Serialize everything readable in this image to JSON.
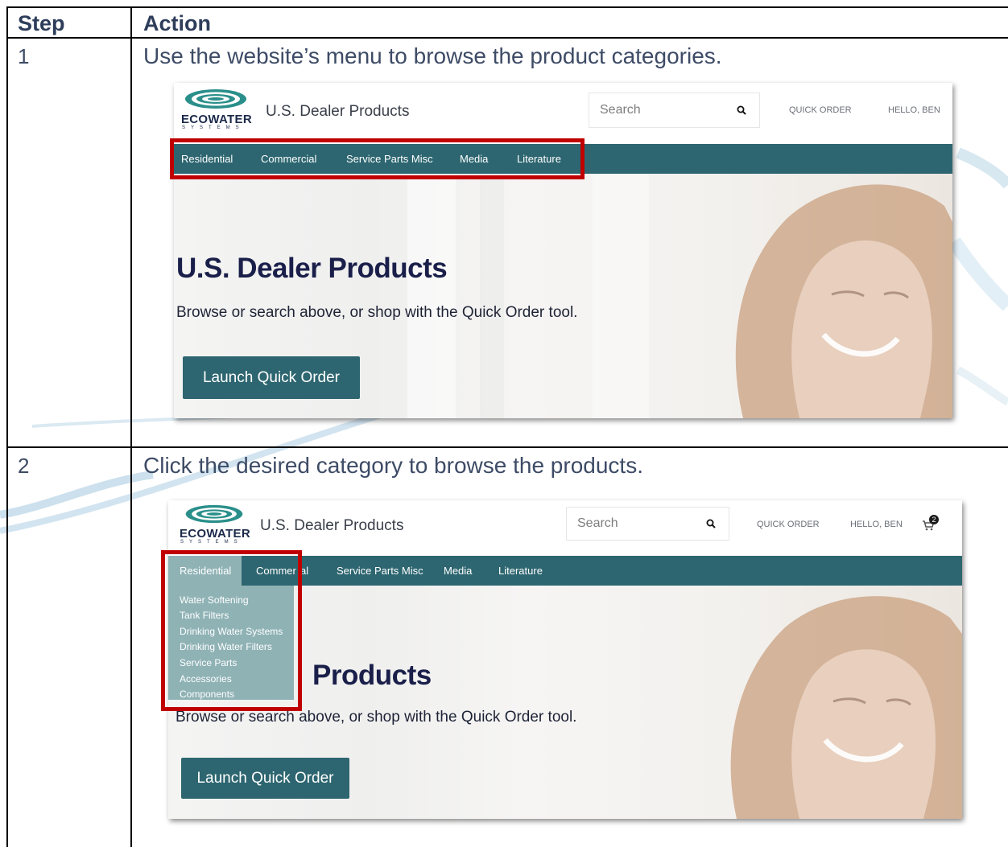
{
  "table": {
    "headers": {
      "step": "Step",
      "action": "Action"
    },
    "rows": [
      {
        "step": "1",
        "action": "Use the website’s menu to browse the product categories."
      },
      {
        "step": "2",
        "action": "Click the desired category to browse the products."
      }
    ]
  },
  "colors": {
    "nav": "#2d6670",
    "highlight": "#c00000",
    "dropdown": "#8fb2b5"
  },
  "screenshot1": {
    "logo_text": "ECOWATER",
    "logo_sub": "SYSTEMS",
    "site_title": "U.S. Dealer Products",
    "search_placeholder": "Search",
    "quick_order": "QUICK ORDER",
    "greeting": "HELLO, BEN",
    "nav": [
      "Residential",
      "Commercial",
      "Service Parts Misc",
      "Media",
      "Literature"
    ],
    "hero_title": "U.S. Dealer Products",
    "hero_sub": "Browse or search above, or shop with the Quick Order tool.",
    "cta": "Launch Quick Order"
  },
  "screenshot2": {
    "logo_text": "ECOWATER",
    "logo_sub": "SYSTEMS",
    "site_title": "U.S. Dealer Products",
    "search_placeholder": "Search",
    "quick_order": "QUICK ORDER",
    "greeting": "HELLO, BEN",
    "cart_count": "2",
    "nav": [
      "Residential",
      "Commer",
      "al",
      "Service Parts Misc",
      "Media",
      "Literature"
    ],
    "dropdown": [
      "Water Softening",
      "Tank Filters",
      "Drinking Water Systems",
      "Drinking Water Filters",
      "Service Parts",
      "Accessories",
      "Components"
    ],
    "hero_title_partial": "Products",
    "hero_sub": "Browse or search above, or shop with the Quick Order tool.",
    "cta": "Launch Quick Order"
  }
}
